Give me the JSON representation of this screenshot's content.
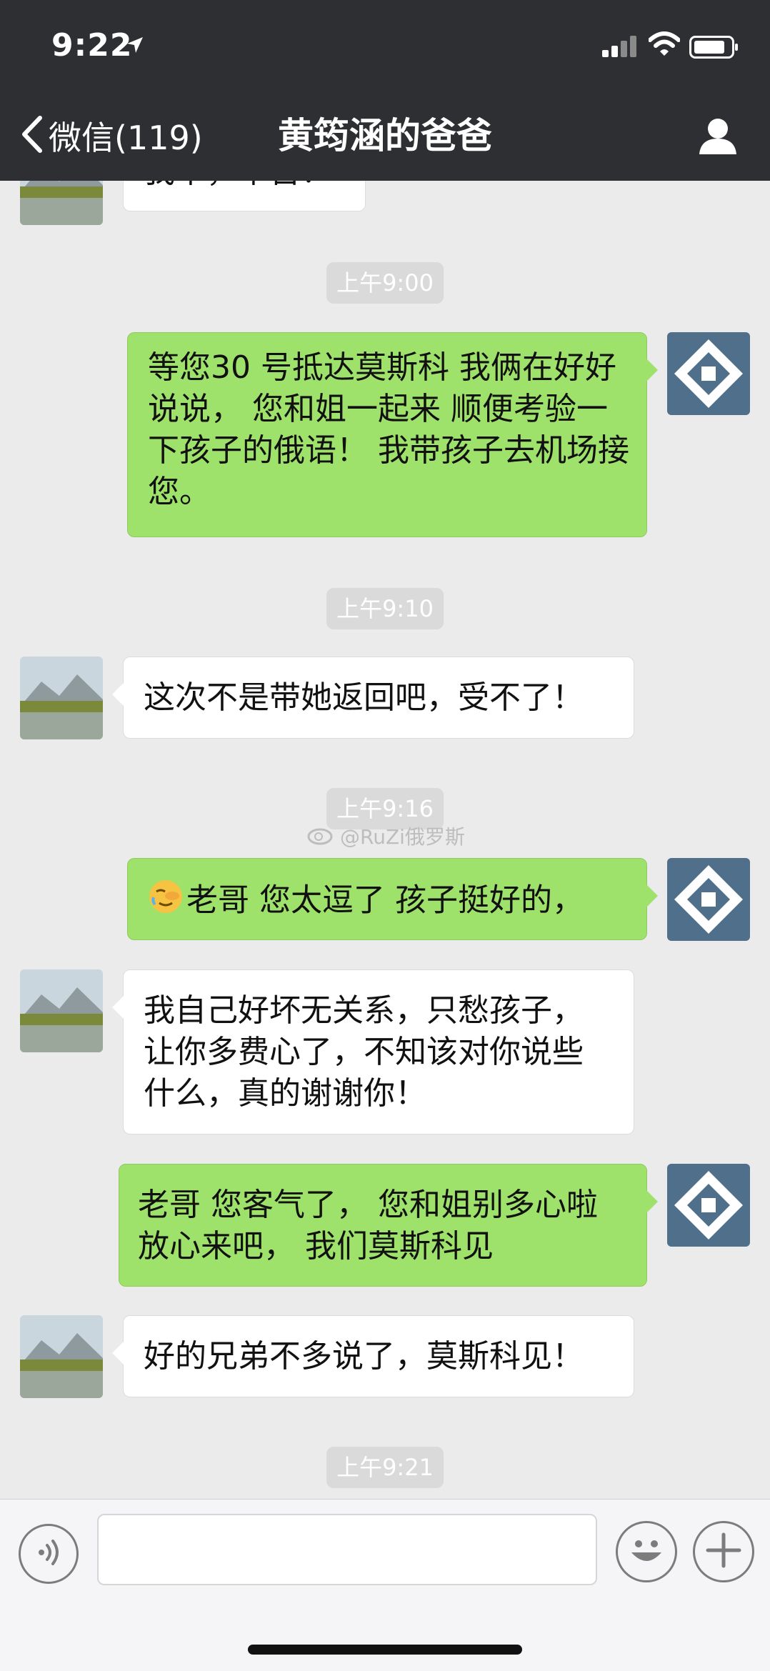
{
  "status": {
    "time": "9:22"
  },
  "nav": {
    "back_label": "微信(119)",
    "title": "黄筠涵的爸爸"
  },
  "messages": {
    "partial": "我辛，辛苦！",
    "stamp1": "上午9:00",
    "out1": "等您30 号抵达莫斯科 我俩在好好说说， 您和姐一起来 顺便考验一下孩子的俄语！ 我带孩子去机场接您。",
    "stamp2": "上午9:10",
    "in1": "这次不是带她返回吧，受不了！",
    "stamp3": "上午9:16",
    "out2": "老哥 您太逗了 孩子挺好的，",
    "in2": "我自己好坏无关系，只愁孩子，让你多费心了，不知该对你说些什么，真的谢谢你！",
    "out3": "老哥 您客气了， 您和姐别多心啦 放心来吧， 我们莫斯科见",
    "in3": "好的兄弟不多说了，莫斯科见！",
    "stamp4": "上午9:21"
  },
  "watermark": "@RuZi俄罗斯",
  "icons": {
    "voice": "voice-icon",
    "emoji": "emoji-icon",
    "plus": "plus-icon",
    "profile": "profile-icon",
    "back": "chevron-left-icon"
  },
  "colors": {
    "header": "#2e2f33",
    "outgoing": "#9fe26b",
    "incoming": "#ffffff",
    "chat_bg": "#ebebeb"
  }
}
